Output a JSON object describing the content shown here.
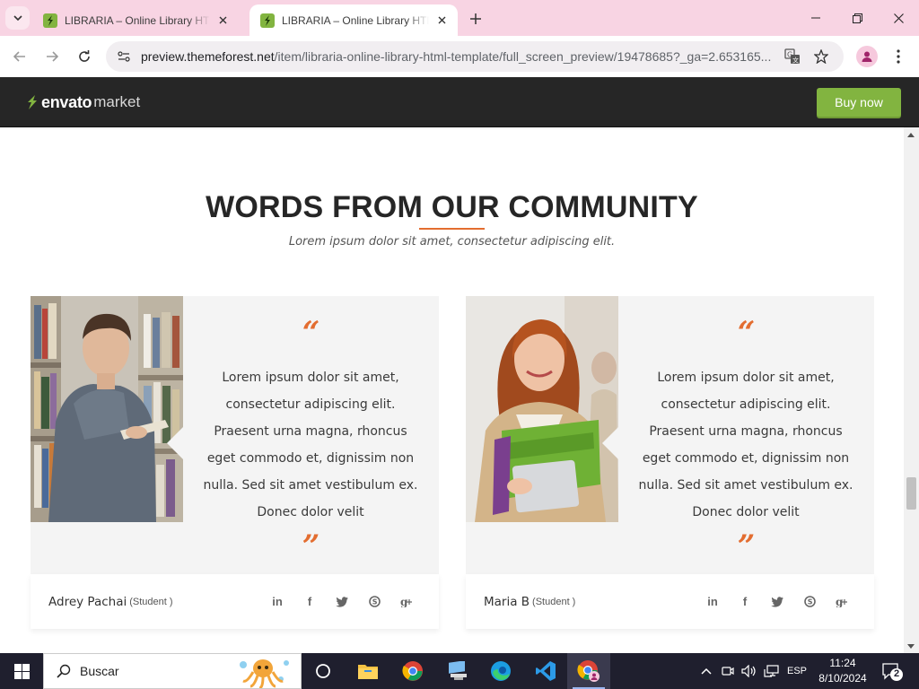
{
  "browser": {
    "tabs": [
      {
        "title": "LIBRARIA – Online Library HTML"
      },
      {
        "title": "LIBRARIA – Online Library HTML"
      }
    ],
    "url_host": "preview.themeforest.net",
    "url_path": "/item/libraria-online-library-html-template/full_screen_preview/19478685?_ga=2.653165..."
  },
  "envato": {
    "brand": "envato",
    "market": "market",
    "buy_now": "Buy now",
    "accent": "#82b440"
  },
  "section": {
    "title": "WORDS FROM OUR COMMUNITY",
    "subtitle": "Lorem ipsum dolor sit amet, consectetur adipiscing elit.",
    "accent": "#e36d30"
  },
  "testimonials": [
    {
      "quote_open": "“",
      "quote_close": "”",
      "lines": [
        "Lorem ipsum dolor sit amet,",
        "consectetur adipiscing elit.",
        "Praesent urna magna, rhoncus",
        "eget commodo et, dignissim non",
        "nulla. Sed sit amet vestibulum ex.",
        "Donec dolor velit"
      ],
      "author": "Adrey Pachai",
      "role": "(Student )"
    },
    {
      "quote_open": "“",
      "quote_close": "”",
      "lines": [
        "Lorem ipsum dolor sit amet,",
        "consectetur adipiscing elit.",
        "Praesent urna magna, rhoncus",
        "eget commodo et, dignissim non",
        "nulla. Sed sit amet vestibulum ex.",
        "Donec dolor velit"
      ],
      "author": "Maria B",
      "role": "(Student )"
    }
  ],
  "social_icons": [
    "linkedin-icon",
    "facebook-icon",
    "twitter-icon",
    "skype-icon",
    "google-plus-icon"
  ],
  "taskbar": {
    "search_label": "Buscar",
    "language": "ESP",
    "time": "11:24",
    "date": "8/10/2024",
    "notifications": "2"
  }
}
